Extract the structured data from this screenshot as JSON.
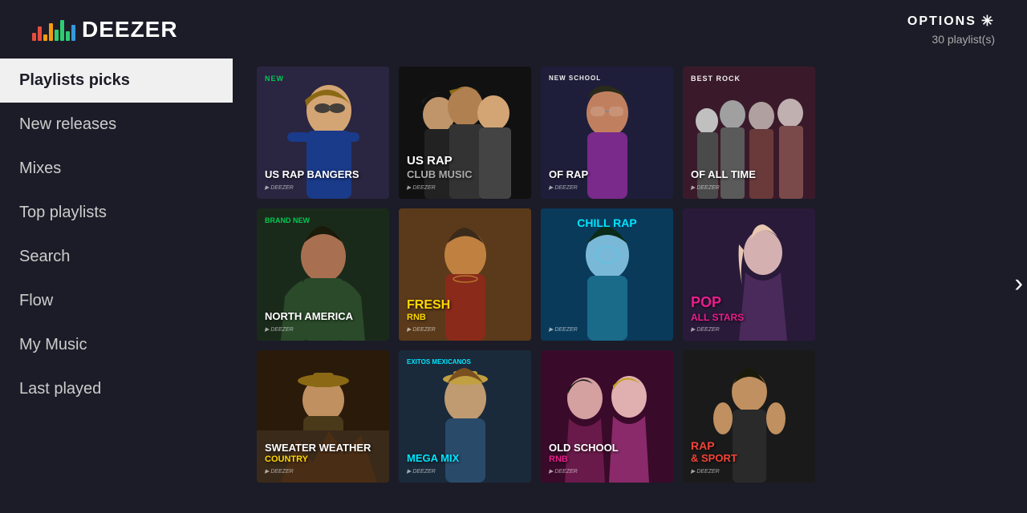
{
  "header": {
    "logo_text": "DEEZER",
    "options_label": "OPTIONS",
    "playlist_count": "30 playlist(s)"
  },
  "sidebar": {
    "items": [
      {
        "id": "playlists-picks",
        "label": "Playlists picks",
        "active": true
      },
      {
        "id": "new-releases",
        "label": "New releases",
        "active": false
      },
      {
        "id": "mixes",
        "label": "Mixes",
        "active": false
      },
      {
        "id": "top-playlists",
        "label": "Top playlists",
        "active": false
      },
      {
        "id": "search",
        "label": "Search",
        "active": false
      },
      {
        "id": "flow",
        "label": "Flow",
        "active": false
      },
      {
        "id": "my-music",
        "label": "My Music",
        "active": false
      },
      {
        "id": "last-played",
        "label": "Last played",
        "active": false
      }
    ]
  },
  "grid": {
    "rows": [
      [
        {
          "id": "rap-bangers",
          "top_label": "NEW",
          "title": "US RAP BANGERS",
          "subtitle": "",
          "accent": "green",
          "bg": "rap-bangers"
        },
        {
          "id": "us-rap-club",
          "top_label": "",
          "title": "US RAP",
          "subtitle": "CLUB MUSIC",
          "accent": "white",
          "bg": "us-rap-club"
        },
        {
          "id": "new-school-rap",
          "top_label": "NEW SCHOOL",
          "title": "OF RAP",
          "subtitle": "",
          "accent": "white",
          "bg": "new-school-rap"
        },
        {
          "id": "best-rock",
          "top_label": "BEST ROCK",
          "title": "OF ALL TIME",
          "subtitle": "",
          "accent": "white",
          "bg": "best-rock"
        }
      ],
      [
        {
          "id": "brand-new",
          "top_label": "BRAND NEW",
          "title": "NORTH AMERICA",
          "subtitle": "",
          "accent": "green",
          "bg": "brand-new"
        },
        {
          "id": "fresh-rnb",
          "top_label": "",
          "title": "FRESH",
          "subtitle": "RNB",
          "accent": "yellow",
          "bg": "fresh-rnb"
        },
        {
          "id": "chill-rap",
          "top_label": "",
          "title": "CHILL RAP",
          "subtitle": "",
          "accent": "cyan",
          "bg": "chill-rap"
        },
        {
          "id": "pop-stars",
          "top_label": "",
          "title": "POP",
          "subtitle": "ALL STARS",
          "accent": "pink",
          "bg": "pop-stars"
        }
      ],
      [
        {
          "id": "sweater",
          "top_label": "",
          "title": "SWEATER WEATHER",
          "subtitle": "COUNTRY",
          "accent": "yellow",
          "bg": "sweater"
        },
        {
          "id": "exitos",
          "top_label": "EXITOS MEXICANOS",
          "title": "MEGA MIX",
          "subtitle": "",
          "accent": "cyan",
          "bg": "exitos"
        },
        {
          "id": "old-school",
          "top_label": "",
          "title": "OLD SCHOOL",
          "subtitle": "RNB",
          "accent": "pink",
          "bg": "old-school"
        },
        {
          "id": "rap-sport",
          "top_label": "RAP",
          "title": "& SPORT",
          "subtitle": "",
          "accent": "red",
          "bg": "rap-sport"
        }
      ]
    ]
  }
}
